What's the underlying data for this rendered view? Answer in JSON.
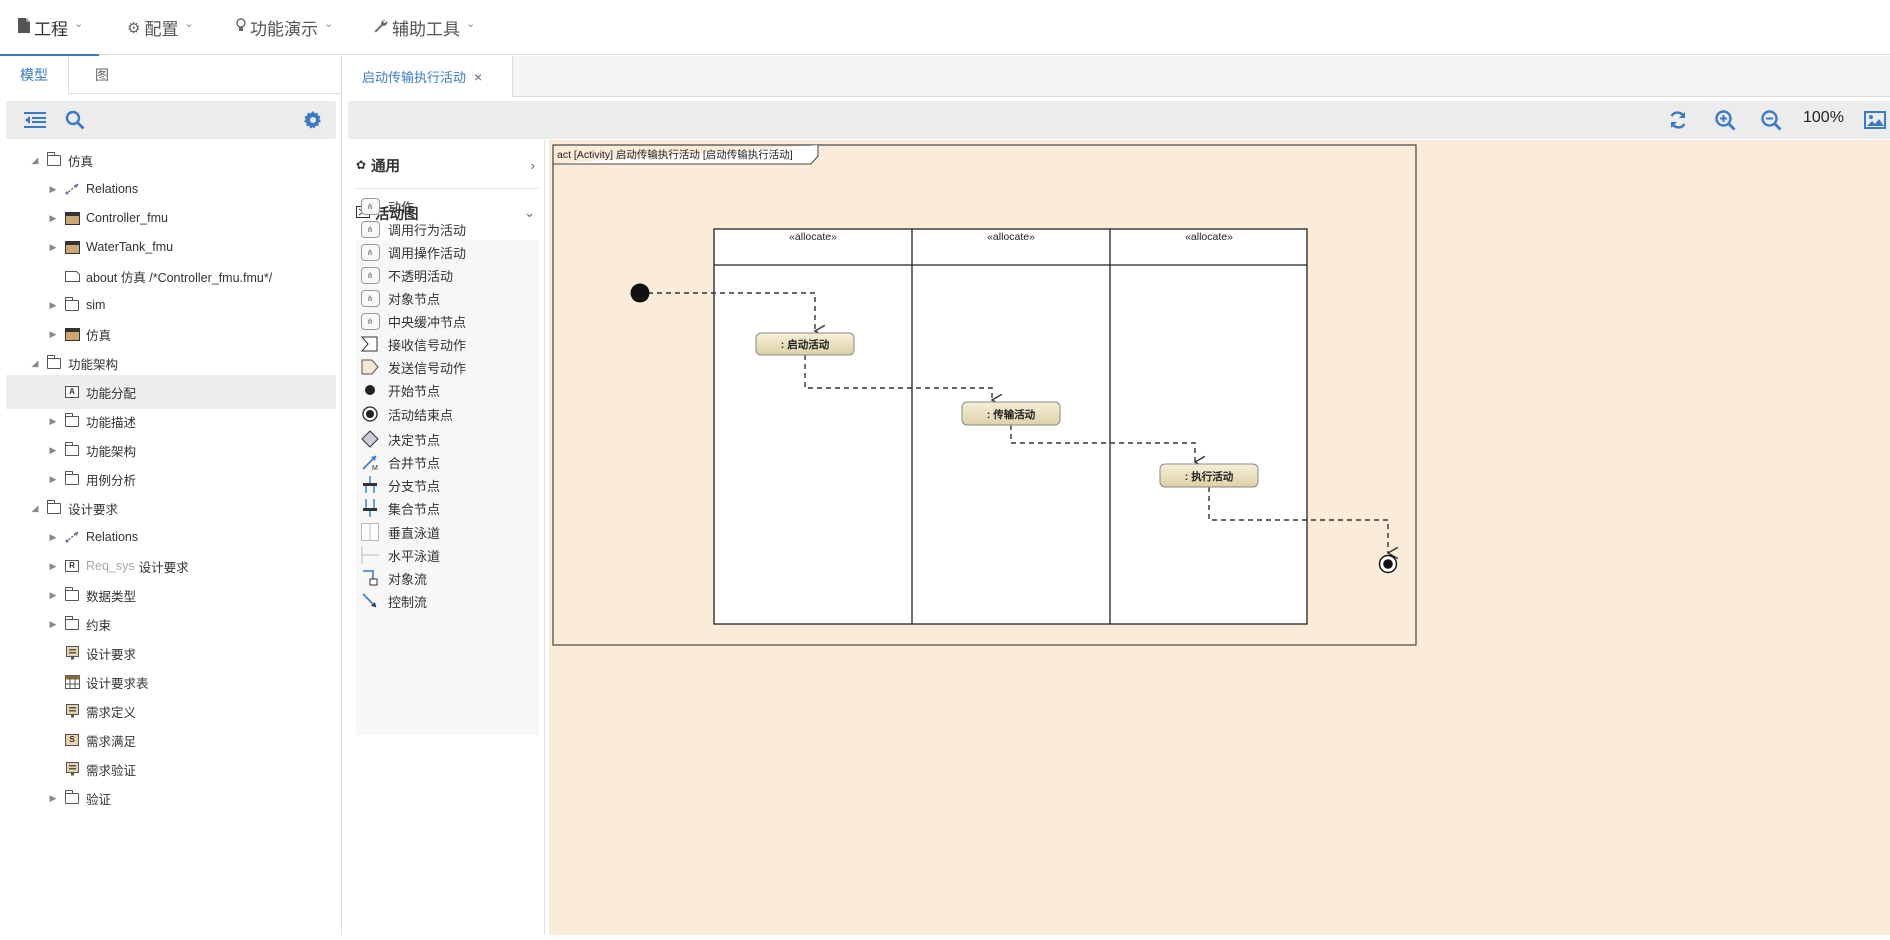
{
  "menubar": {
    "items": [
      {
        "label": "工程",
        "icon": "file-icon"
      },
      {
        "label": "配置",
        "icon": "gears-icon"
      },
      {
        "label": "功能演示",
        "icon": "lightbulb-icon"
      },
      {
        "label": "辅助工具",
        "icon": "wrench-icon"
      }
    ]
  },
  "left_panel": {
    "tabs": [
      "模型",
      "图"
    ],
    "tree": [
      {
        "label": "仿真",
        "level": 1,
        "icon": "folder",
        "state": "open"
      },
      {
        "label": "Relations",
        "level": 2,
        "icon": "relation",
        "state": "closed"
      },
      {
        "label": "Controller_fmu",
        "level": 2,
        "icon": "block",
        "state": "closed"
      },
      {
        "label": "WaterTank_fmu",
        "level": 2,
        "icon": "block",
        "state": "closed"
      },
      {
        "label": "about 仿真 /*Controller_fmu.fmu*/",
        "level": 2,
        "icon": "comment",
        "state": "leaf"
      },
      {
        "label": "sim",
        "level": 2,
        "icon": "folder",
        "state": "closed"
      },
      {
        "label": "仿真",
        "level": 2,
        "icon": "block",
        "state": "closed"
      },
      {
        "label": "功能架构",
        "level": 1,
        "icon": "folder",
        "state": "open"
      },
      {
        "label": "功能分配",
        "level": 2,
        "icon": "diagram",
        "state": "leaf",
        "selected": true
      },
      {
        "label": "功能描述",
        "level": 2,
        "icon": "folder",
        "state": "closed"
      },
      {
        "label": "功能架构",
        "level": 2,
        "icon": "folder",
        "state": "closed"
      },
      {
        "label": "用例分析",
        "level": 2,
        "icon": "folder",
        "state": "closed"
      },
      {
        "label": "设计要求",
        "level": 1,
        "icon": "folder",
        "state": "open"
      },
      {
        "label": "Relations",
        "level": 2,
        "icon": "relation",
        "state": "closed"
      },
      {
        "label": "设计要求",
        "sub": "Req_sys",
        "level": 2,
        "icon": "req",
        "state": "closed"
      },
      {
        "label": "数据类型",
        "level": 2,
        "icon": "folder",
        "state": "closed"
      },
      {
        "label": "约束",
        "level": 2,
        "icon": "folder",
        "state": "closed"
      },
      {
        "label": "设计要求",
        "level": 2,
        "icon": "req-diagram",
        "state": "leaf"
      },
      {
        "label": "设计要求表",
        "level": 2,
        "icon": "table",
        "state": "leaf"
      },
      {
        "label": "需求定义",
        "level": 2,
        "icon": "req-diagram",
        "state": "leaf"
      },
      {
        "label": "需求满足",
        "level": 2,
        "icon": "satisfy",
        "state": "leaf"
      },
      {
        "label": "需求验证",
        "level": 2,
        "icon": "req-diagram",
        "state": "leaf"
      },
      {
        "label": "验证",
        "level": 2,
        "icon": "folder",
        "state": "closed"
      }
    ]
  },
  "editor": {
    "tab_label": "启动传输执行活动",
    "close_glyph": "×",
    "zoom": "100%"
  },
  "palette": {
    "sections": [
      {
        "label": "通用",
        "expanded": false
      },
      {
        "label": "活动图",
        "expanded": true
      }
    ],
    "items": [
      {
        "label": "动作",
        "icon": "action-icon"
      },
      {
        "label": "调用行为活动",
        "icon": "call-behavior-icon"
      },
      {
        "label": "调用操作活动",
        "icon": "call-operation-icon"
      },
      {
        "label": "不透明活动",
        "icon": "opaque-action-icon"
      },
      {
        "label": "对象节点",
        "icon": "object-node-icon"
      },
      {
        "label": "中央缓冲节点",
        "icon": "central-buffer-icon"
      },
      {
        "label": "接收信号动作",
        "icon": "accept-signal-icon"
      },
      {
        "label": "发送信号动作",
        "icon": "send-signal-icon"
      },
      {
        "label": "开始节点",
        "icon": "initial-node-icon"
      },
      {
        "label": "活动结束点",
        "icon": "final-node-icon"
      },
      {
        "label": "决定节点",
        "icon": "decision-node-icon"
      },
      {
        "label": "合并节点",
        "icon": "merge-node-icon"
      },
      {
        "label": "分支节点",
        "icon": "fork-node-icon"
      },
      {
        "label": "集合节点",
        "icon": "join-node-icon"
      },
      {
        "label": "垂直泳道",
        "icon": "vertical-swimlane-icon"
      },
      {
        "label": "水平泳道",
        "icon": "horizontal-swimlane-icon"
      },
      {
        "label": "对象流",
        "icon": "object-flow-icon"
      },
      {
        "label": "控制流",
        "icon": "control-flow-icon"
      }
    ]
  },
  "diagram": {
    "frame_label": "act [Activity] 启动传输执行活动 [启动传输执行活动]",
    "partitions": [
      "«allocate»",
      "«allocate»",
      "«allocate»"
    ],
    "actions": [
      ": 启动活动",
      ": 传输活动",
      ": 执行活动"
    ]
  }
}
